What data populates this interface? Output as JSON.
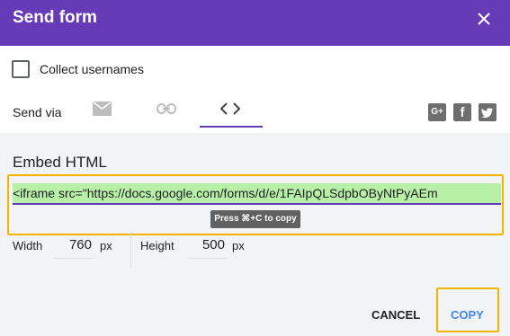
{
  "dialog": {
    "title": "Send form",
    "close_icon": "close-icon"
  },
  "collect": {
    "label": "Collect usernames",
    "checked": false
  },
  "send_via": {
    "label": "Send via",
    "tabs": [
      {
        "icon": "mail-icon",
        "selected": false
      },
      {
        "icon": "link-icon",
        "selected": false
      },
      {
        "icon": "embed-code-icon",
        "selected": true
      }
    ],
    "social": [
      {
        "icon": "google-plus-icon",
        "text": "G+"
      },
      {
        "icon": "facebook-icon",
        "text": "f"
      },
      {
        "icon": "twitter-icon"
      }
    ]
  },
  "embed": {
    "title": "Embed HTML",
    "code": "<iframe src=\"https://docs.google.com/forms/d/e/1FAIpQLSdpbOByNtPyAEm",
    "tooltip": "Press ⌘+C to copy"
  },
  "dimensions": {
    "width_label": "Width",
    "width_value": "760",
    "height_label": "Height",
    "height_value": "500",
    "unit": "px"
  },
  "actions": {
    "cancel": "CANCEL",
    "copy": "COPY"
  },
  "colors": {
    "header": "#673ab7",
    "highlight": "#f4b400",
    "copy": "#4285f4",
    "selection": "#b9f0a8"
  }
}
